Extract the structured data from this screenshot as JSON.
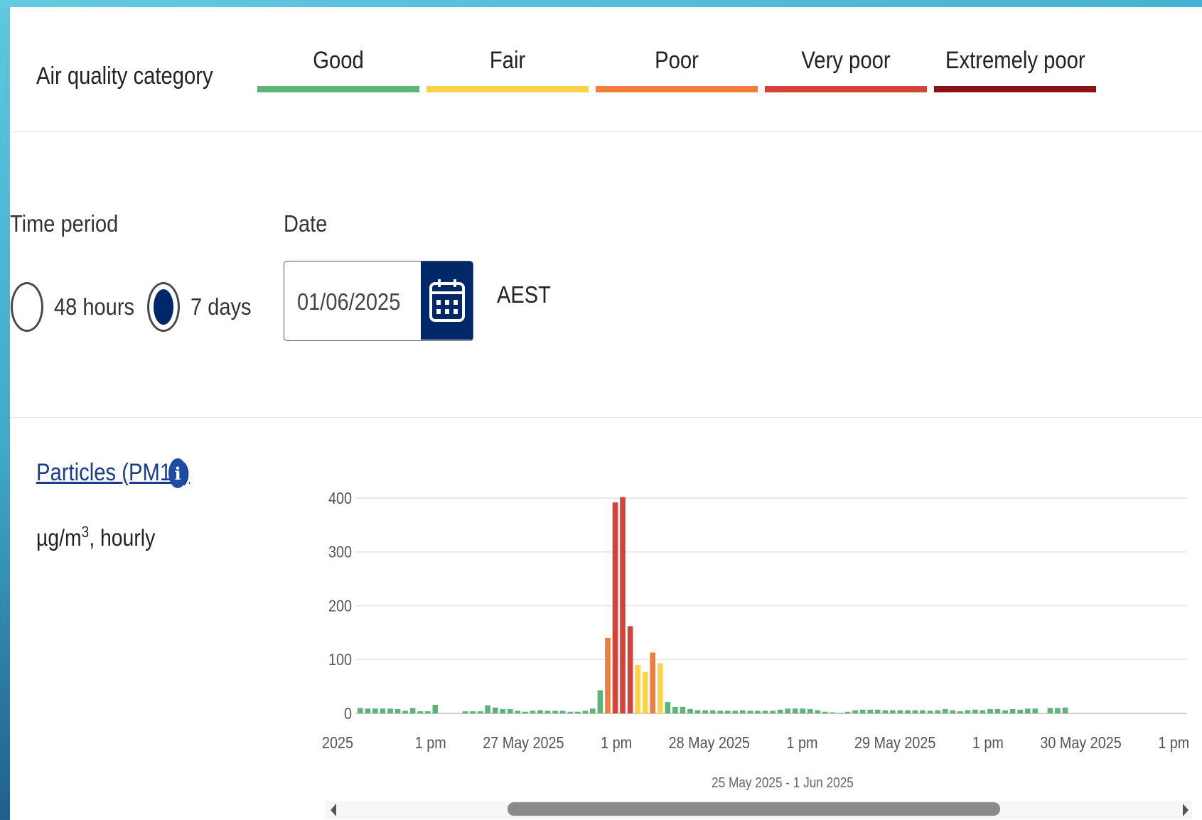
{
  "legend": {
    "title": "Air quality category",
    "categories": [
      {
        "label": "Good",
        "color": "#5db378"
      },
      {
        "label": "Fair",
        "color": "#fbd34a"
      },
      {
        "label": "Poor",
        "color": "#f07d3a"
      },
      {
        "label": "Very poor",
        "color": "#d2433a"
      },
      {
        "label": "Extremely poor",
        "color": "#8c1313"
      }
    ]
  },
  "controls": {
    "time_period_label": "Time period",
    "options": [
      {
        "label": "48 hours",
        "checked": false
      },
      {
        "label": "7 days",
        "checked": true
      }
    ],
    "date_label": "Date",
    "date_value": "01/06/2025",
    "timezone": "AEST"
  },
  "pollutant": {
    "name": "Particles (PM10)",
    "unit_prefix": "µg/m",
    "unit_sup": "3",
    "unit_suffix": ", hourly"
  },
  "chart_data": {
    "type": "bar",
    "ylim": [
      0,
      400
    ],
    "yticks": [
      0,
      100,
      200,
      300,
      400
    ],
    "xticks": [
      "2025",
      "1 pm",
      "27 May 2025",
      "1 pm",
      "28 May 2025",
      "1 pm",
      "29 May 2025",
      "1 pm",
      "30 May 2025",
      "1 pm"
    ],
    "range_label": "25 May 2025 - 1 Jun 2025",
    "grid": true,
    "values": [
      10,
      9,
      9,
      9,
      9,
      8,
      5,
      10,
      4,
      4,
      16,
      4,
      4,
      4,
      15,
      11,
      8,
      8,
      5,
      3,
      5,
      6,
      5,
      5,
      5,
      3,
      3,
      5,
      9,
      43,
      140,
      392,
      402,
      162,
      90,
      77,
      113,
      93,
      21,
      12,
      12,
      8,
      6,
      6,
      6,
      5,
      5,
      5,
      6,
      5,
      5,
      5,
      5,
      7,
      9,
      9,
      9,
      8,
      6,
      3,
      2,
      1,
      3,
      6,
      7,
      7,
      7,
      6,
      6,
      6,
      6,
      6,
      6,
      5,
      6,
      8,
      6,
      4,
      6,
      7,
      6,
      8,
      8,
      6,
      8,
      7,
      9,
      9,
      0,
      10,
      10,
      11
    ],
    "category_colors": {
      "good": "#5db378",
      "fair": "#fbd34a",
      "poor": "#f07d3a",
      "very_poor": "#d2433a"
    }
  }
}
